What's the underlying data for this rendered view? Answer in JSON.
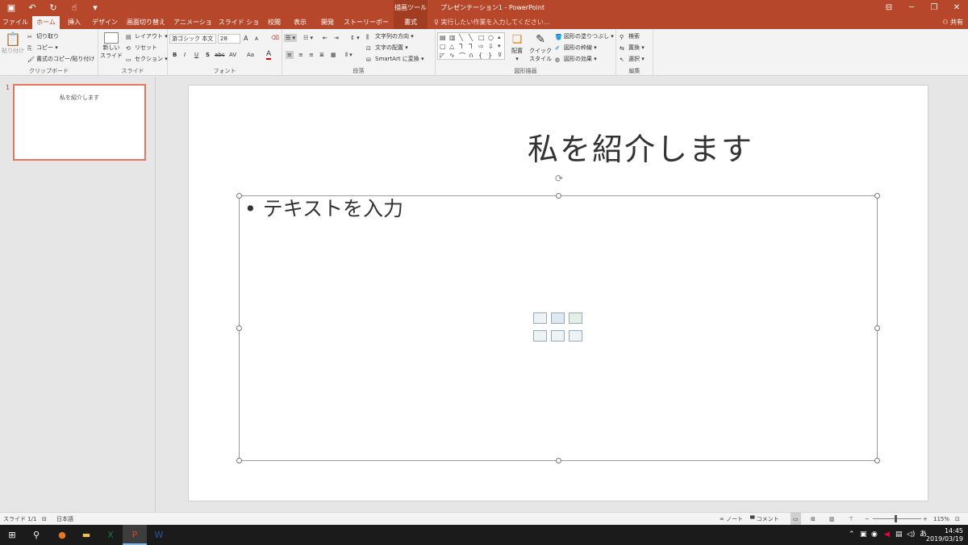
{
  "titlebar": {
    "qat_icons": [
      "save-icon",
      "undo-icon",
      "redo-icon",
      "touch-mode-icon",
      "customize-icon"
    ],
    "tool_context": "描画ツール",
    "doc_title": "プレゼンテーション1 - PowerPoint"
  },
  "tabs": {
    "file": "ファイル",
    "home": "ホーム",
    "insert": "挿入",
    "design": "デザイン",
    "transitions": "画面切り替え",
    "animations": "アニメーション",
    "slideshow": "スライド ショー",
    "review": "校閲",
    "view": "表示",
    "developer": "開発",
    "storyboard": "ストーリーボード",
    "format": "書式",
    "tell_me": "実行したい作業を入力してください...",
    "share": "共有"
  },
  "ribbon": {
    "clipboard": {
      "paste": "貼り付け",
      "cut": "切り取り",
      "copy": "コピー",
      "format_painter": "書式のコピー/貼り付け",
      "label": "クリップボード"
    },
    "slides": {
      "new_slide": "新しい",
      "new_slide2": "スライド",
      "layout": "レイアウト",
      "reset": "リセット",
      "section": "セクション",
      "label": "スライド"
    },
    "font": {
      "font_name": "游ゴシック 本文",
      "font_size": "28",
      "bold": "B",
      "italic": "I",
      "underline": "U",
      "shadow": "S",
      "strike": "abc",
      "spacing": "AV",
      "case": "Aa",
      "color": "A",
      "grow": "A",
      "shrink": "A",
      "label": "フォント"
    },
    "paragraph": {
      "text_direction": "文字列の方向",
      "align_text": "文字の配置",
      "smartart": "SmartArt に変換",
      "label": "段落"
    },
    "drawing": {
      "arrange": "配置",
      "quick_styles": "クイック",
      "quick_styles2": "スタイル",
      "shape_fill": "図形の塗りつぶし",
      "shape_outline": "図形の枠線",
      "shape_effects": "図形の効果",
      "label": "図形描画"
    },
    "editing": {
      "find": "検索",
      "replace": "置換",
      "select": "選択",
      "label": "編集"
    }
  },
  "thumbnail": {
    "number": "1",
    "title": "私を紹介します"
  },
  "slide": {
    "title": "私を紹介します",
    "bullet": "• テキストを入力"
  },
  "statusbar": {
    "slide_count": "スライド 1/1",
    "language": "日本語",
    "notes": "ノート",
    "comments": "コメント",
    "zoom": "115%",
    "zoom_minus": "−",
    "zoom_plus": "+"
  },
  "taskbar": {
    "time": "14:45",
    "date": "2019/03/19",
    "ime": "あ"
  },
  "colors": {
    "accent": "#b7472a",
    "thumb_border": "#e4765b"
  }
}
